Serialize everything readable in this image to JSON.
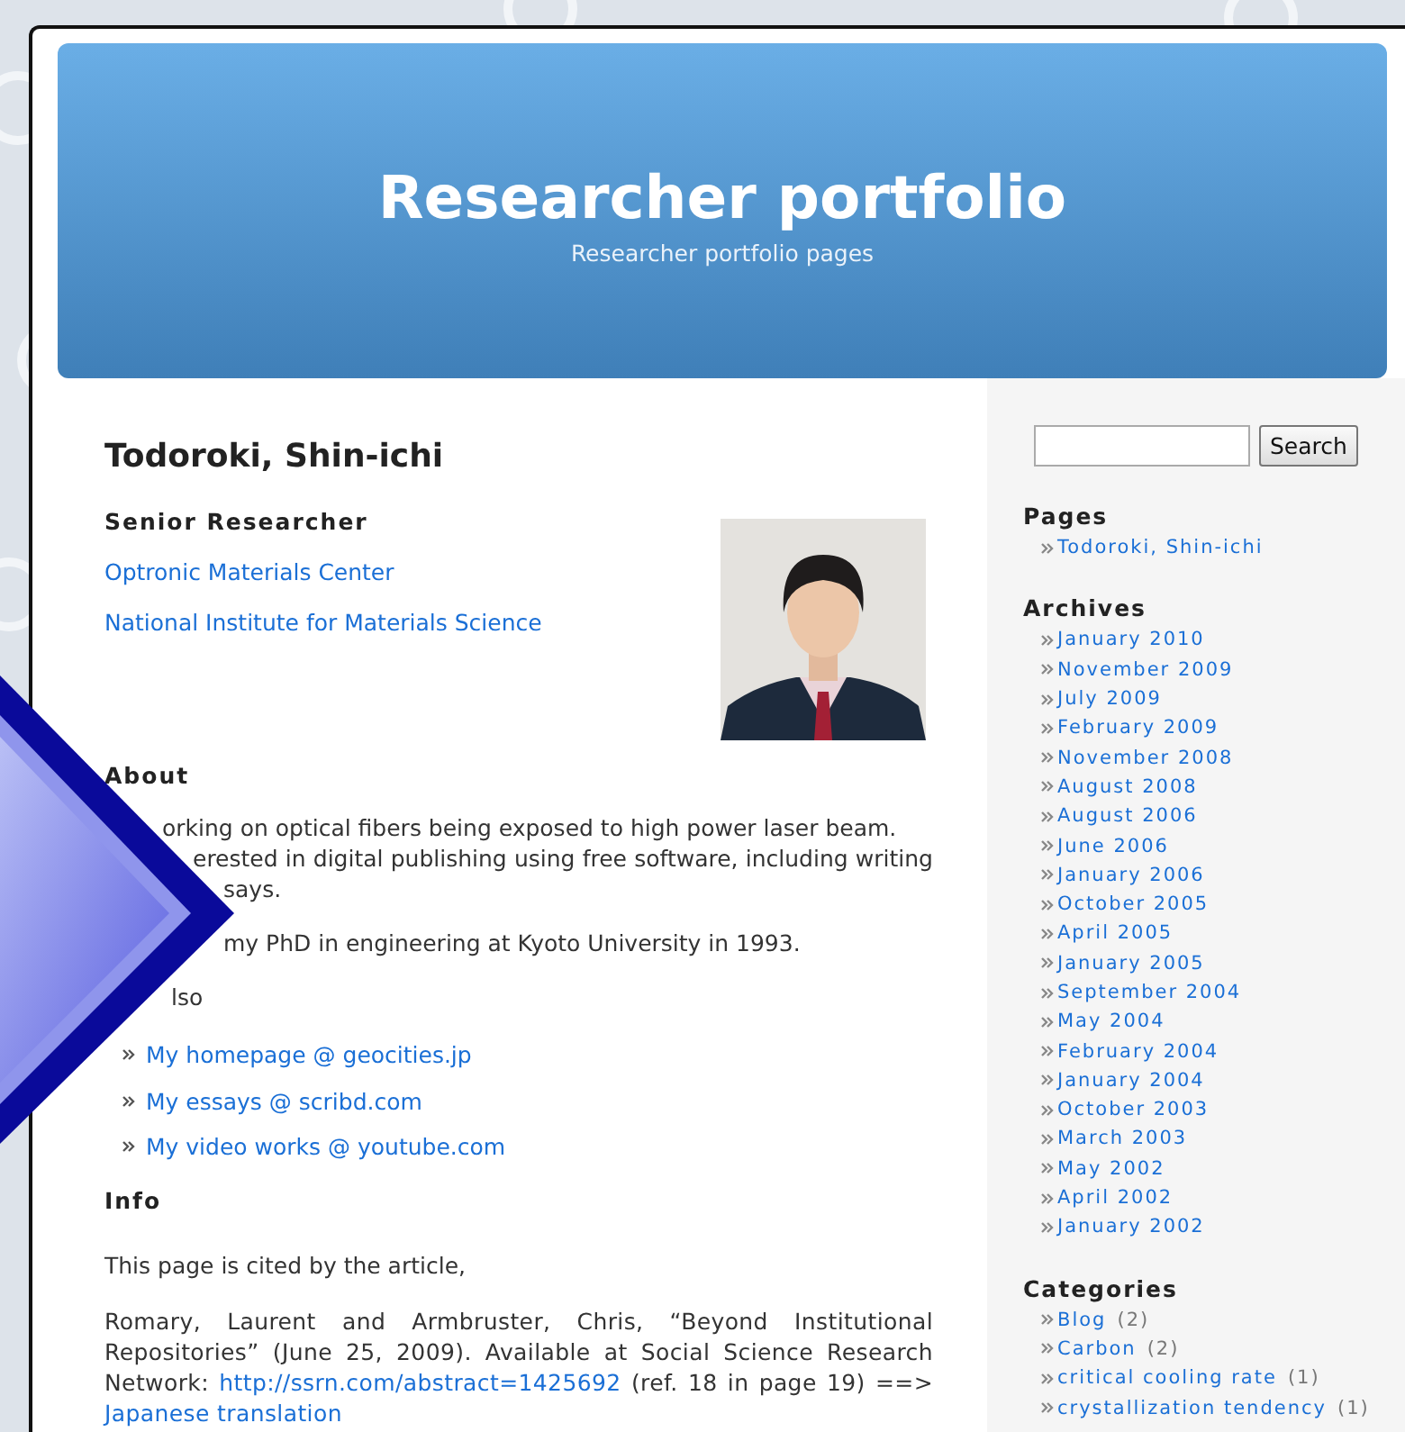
{
  "header": {
    "title": "Researcher portfolio",
    "tagline": "Researcher portfolio pages"
  },
  "main": {
    "name": "Todoroki, Shin-ichi",
    "position": "Senior Researcher",
    "affiliations": [
      "Optronic Materials Center",
      "National Institute for Materials Science"
    ],
    "photo": {
      "kind": "picture"
    },
    "about": {
      "heading": "About",
      "lines": [
        "orking on optical fibers being exposed to high power laser beam.",
        "erested in digital publishing using free software, including writing",
        "says."
      ],
      "phd": "my PhD in engineering at Kyoto University in 1993.",
      "see_also_heading": "lso",
      "links": [
        "My homepage @ geocities.jp",
        "My essays @ scribd.com",
        "My video works @ youtube.com"
      ]
    },
    "info": {
      "heading": "Info",
      "cited": "This page is cited by the article,",
      "citation": [
        {
          "kind": "text",
          "text": "Romary, Laurent and Armbruster, Chris, “Beyond Institutional Repositories” (June 25, 2009). Available at Social Science Research Network: "
        },
        {
          "kind": "link",
          "text": "http://ssrn.com/abstract=1425692"
        },
        {
          "kind": "text",
          "text": " (ref. 18 in page 19) ==> "
        },
        {
          "kind": "link",
          "text": "Japanese translation"
        }
      ]
    }
  },
  "sidebar": {
    "search_button": "Search",
    "pages": {
      "heading": "Pages",
      "items": [
        "Todoroki, Shin-ichi"
      ]
    },
    "archives": {
      "heading": "Archives",
      "items": [
        "January 2010",
        "November 2009",
        "July 2009",
        "February 2009",
        "November 2008",
        "August 2008",
        "August 2006",
        "June 2006",
        "January 2006",
        "October 2005",
        "April 2005",
        "January 2005",
        "September 2004",
        "May 2004",
        "February 2004",
        "January 2004",
        "October 2003",
        "March 2003",
        "May 2002",
        "April 2002",
        "January 2002"
      ]
    },
    "categories": {
      "heading": "Categories",
      "items": [
        {
          "label": "Blog",
          "count": "(2)"
        },
        {
          "label": "Carbon",
          "count": "(2)"
        },
        {
          "label": "critical cooling rate",
          "count": "(1)"
        },
        {
          "label": "crystallization tendency",
          "count": "(1)"
        }
      ]
    }
  }
}
